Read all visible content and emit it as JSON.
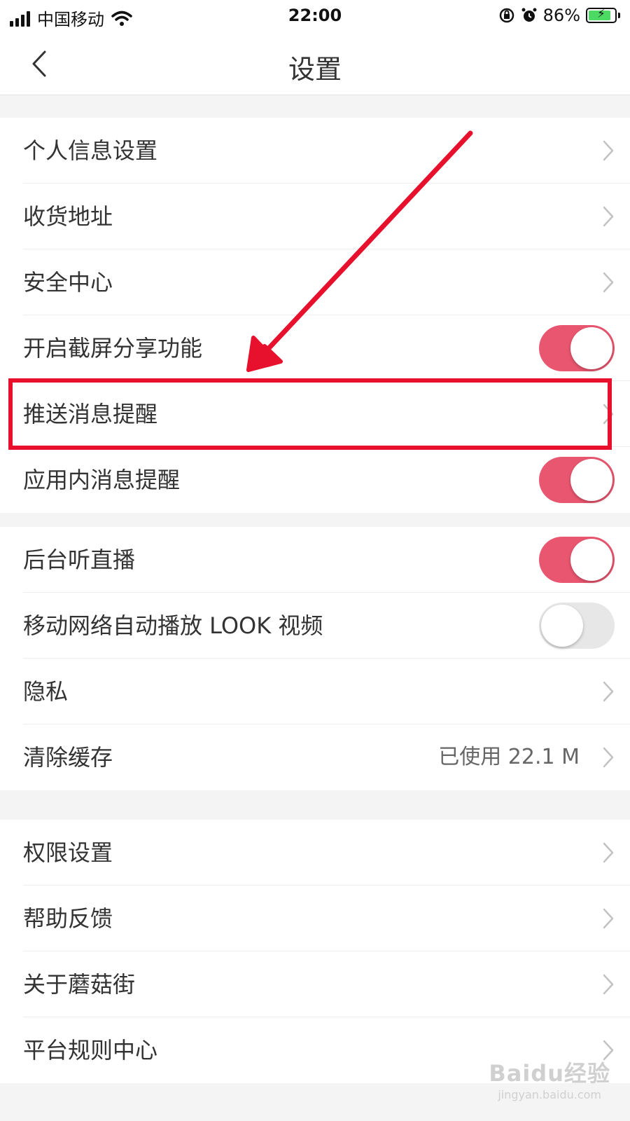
{
  "status_bar": {
    "carrier": "中国移动",
    "time": "22:00",
    "battery_percent": "86%",
    "battery_level": 0.86,
    "icons": [
      "signal-icon",
      "wifi-icon",
      "orientation-lock-icon",
      "alarm-icon",
      "battery-charging-icon"
    ]
  },
  "nav": {
    "title": "设置",
    "back_icon": "back-chevron-icon"
  },
  "groups": [
    {
      "rows": [
        {
          "label": "个人信息设置",
          "control": "chevron"
        },
        {
          "label": "收货地址",
          "control": "chevron"
        },
        {
          "label": "安全中心",
          "control": "chevron"
        },
        {
          "label": "开启截屏分享功能",
          "control": "toggle",
          "on": true
        },
        {
          "label": "推送消息提醒",
          "control": "chevron",
          "highlighted": true
        },
        {
          "label": "应用内消息提醒",
          "control": "toggle",
          "on": true
        }
      ]
    },
    {
      "rows": [
        {
          "label": "后台听直播",
          "control": "toggle",
          "on": true
        },
        {
          "label": "移动网络自动播放 LOOK 视频",
          "control": "toggle",
          "on": false
        },
        {
          "label": "隐私",
          "control": "chevron"
        },
        {
          "label": "清除缓存",
          "value": "已使用 22.1 M",
          "control": "chevron"
        }
      ]
    },
    {
      "rows": [
        {
          "label": "权限设置",
          "control": "chevron"
        },
        {
          "label": "帮助反馈",
          "control": "chevron"
        },
        {
          "label": "关于蘑菇街",
          "control": "chevron"
        },
        {
          "label": "平台规则中心",
          "control": "chevron"
        }
      ]
    }
  ],
  "colors": {
    "toggle_on": "#e9566f",
    "toggle_off": "#e7e7e7",
    "annotation": "#e8112d",
    "background": "#f4f4f4"
  },
  "watermark": {
    "main": "Baidu经验",
    "sub": "jingyan.baidu.com"
  }
}
